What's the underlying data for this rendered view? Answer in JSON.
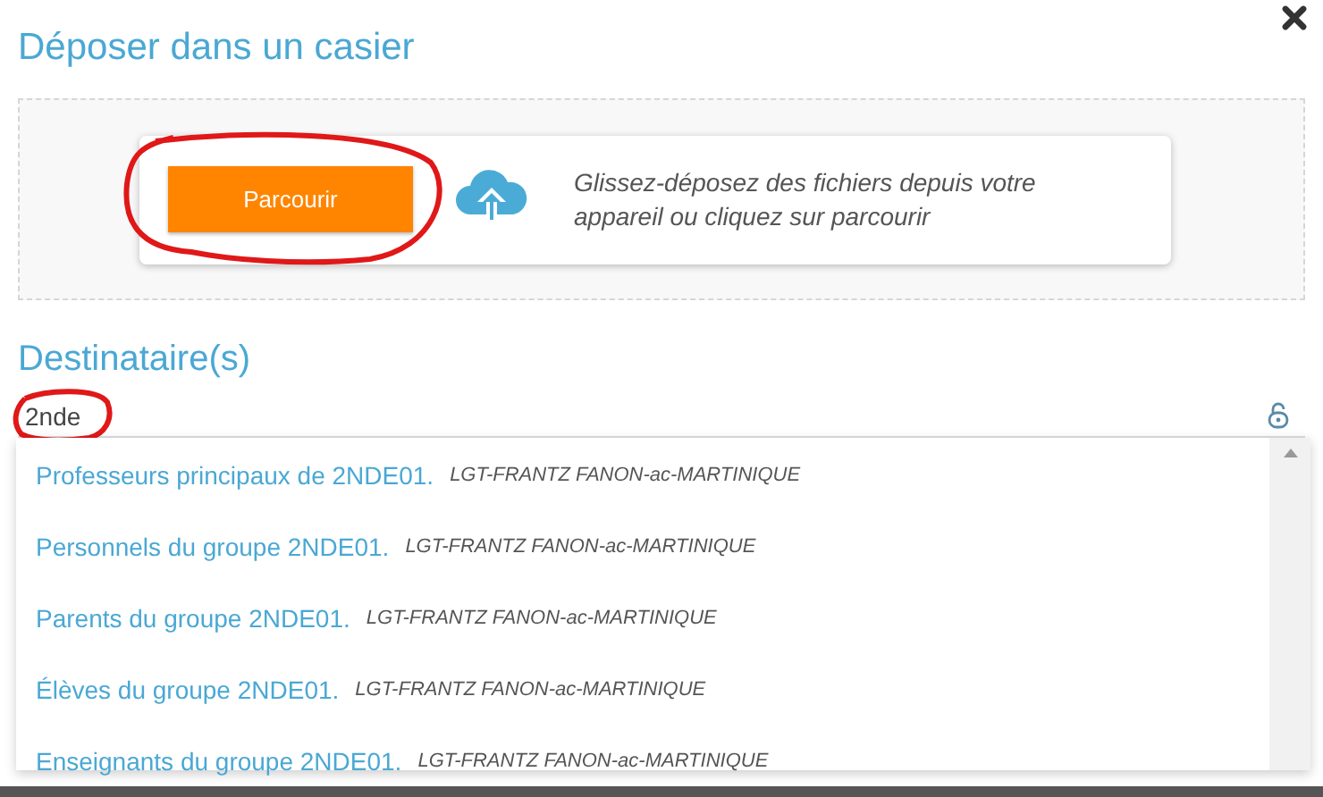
{
  "title": "Déposer dans un casier",
  "dropzone": {
    "button": "Parcourir",
    "hint": "Glissez-déposez des fichiers depuis votre appareil ou cliquez sur parcourir"
  },
  "recipients": {
    "heading": "Destinataire(s)",
    "search": {
      "value": "2nde"
    },
    "suggestions": [
      {
        "name": "Professeurs principaux de 2NDE01.",
        "school": "LGT-FRANTZ FANON-ac-MARTINIQUE"
      },
      {
        "name": "Personnels du groupe 2NDE01.",
        "school": "LGT-FRANTZ FANON-ac-MARTINIQUE"
      },
      {
        "name": "Parents du groupe 2NDE01.",
        "school": "LGT-FRANTZ FANON-ac-MARTINIQUE"
      },
      {
        "name": "Élèves du groupe 2NDE01.",
        "school": "LGT-FRANTZ FANON-ac-MARTINIQUE"
      },
      {
        "name": "Enseignants du groupe 2NDE01.",
        "school": "LGT-FRANTZ FANON-ac-MARTINIQUE"
      }
    ]
  }
}
